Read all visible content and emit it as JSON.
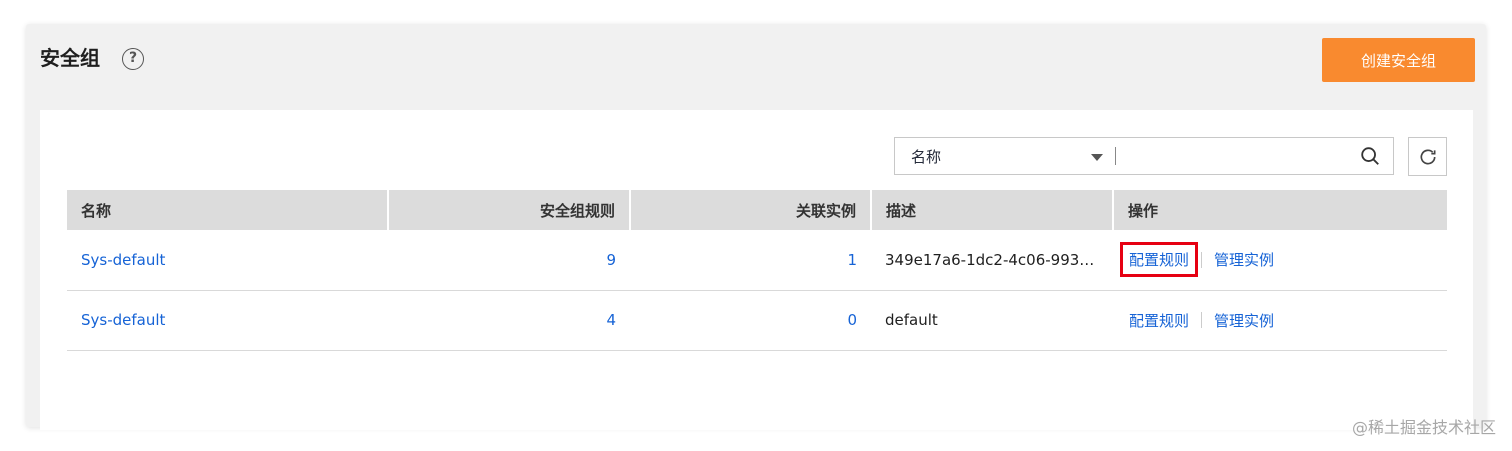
{
  "header": {
    "title": "安全组",
    "help_icon": "question-circle-icon",
    "create_button": "创建安全组",
    "accent_color": "#f98a2f"
  },
  "search": {
    "field_selected": "名称",
    "placeholder": "",
    "search_icon": "search-icon",
    "refresh_icon": "refresh-icon"
  },
  "table": {
    "columns": [
      "名称",
      "安全组规则",
      "关联实例",
      "描述",
      "操作"
    ],
    "rows": [
      {
        "name": "Sys-default",
        "rules": "9",
        "instances": "1",
        "description": "349e17a6-1dc2-4c06-9931...",
        "action_config": "配置规则",
        "action_manage": "管理实例"
      },
      {
        "name": "Sys-default",
        "rules": "4",
        "instances": "0",
        "description": "default",
        "action_config": "配置规则",
        "action_manage": "管理实例"
      }
    ],
    "link_color": "#1663d6",
    "highlight_color": "#e60012"
  },
  "watermark": "@稀土掘金技术社区"
}
